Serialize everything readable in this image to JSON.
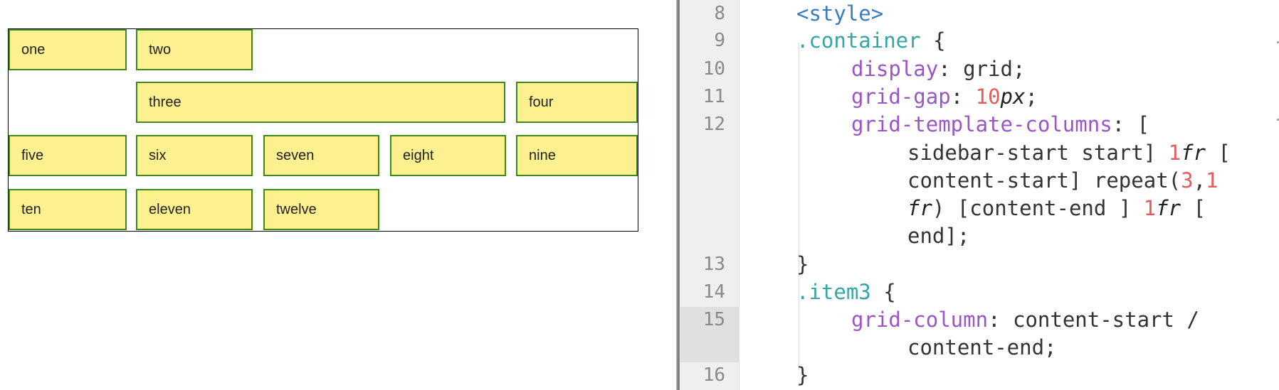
{
  "preview": {
    "items": [
      {
        "label": "one"
      },
      {
        "label": "two"
      },
      {
        "label": "three"
      },
      {
        "label": "four"
      },
      {
        "label": "five"
      },
      {
        "label": "six"
      },
      {
        "label": "seven"
      },
      {
        "label": "eight"
      },
      {
        "label": "nine"
      },
      {
        "label": "ten"
      },
      {
        "label": "eleven"
      },
      {
        "label": "twelve"
      }
    ],
    "colors": {
      "item_fill": "#fdf08f",
      "item_border": "#3d8a1c",
      "container_border": "#000000"
    }
  },
  "editor": {
    "line_numbers": {
      "n8": "8",
      "n9": "9",
      "n10": "10",
      "n11": "11",
      "n12": "12",
      "n13": "13",
      "n14": "14",
      "n15": "15",
      "n16": "16"
    },
    "code": {
      "l8_tag": "<style>",
      "l9_sel": ".container",
      "l9_brace": " {",
      "l10_prop": "display",
      "l10_rest": ": grid;",
      "l11_prop": "grid-gap",
      "l11_colon": ": ",
      "l11_num": "10",
      "l11_unit": "px",
      "l11_end": ";",
      "l12_prop": "grid-template-columns",
      "l12_rest": ": [",
      "l12b_text": "sidebar-start start] ",
      "l12b_num": "1",
      "l12b_unit": "fr",
      "l12b_end": " [",
      "l12c_text": "content-start] repeat(",
      "l12c_num1": "3",
      "l12c_comma": ",",
      "l12c_num2": "1",
      "l12d_unit": "fr",
      "l12d_text": ") [content-end ] ",
      "l12d_num": "1",
      "l12d_unit2": "fr",
      "l12d_end": " [",
      "l12e_text": "end];",
      "l13_brace": "}",
      "l14_sel": ".item3",
      "l14_brace": " {",
      "l15_prop": "grid-column",
      "l15_rest": ": content-start /",
      "l15b_text": "content-end;",
      "l16_brace": "}"
    },
    "colors": {
      "tag": "#3b7bc4",
      "selector": "#35a5a5",
      "property": "#9a55c7",
      "number": "#e35d5d",
      "gutter": "#efefef"
    }
  }
}
